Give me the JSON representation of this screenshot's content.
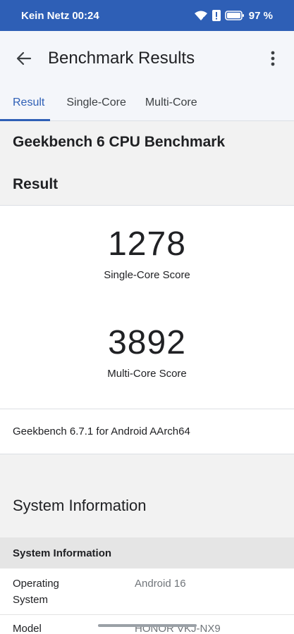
{
  "status_bar": {
    "carrier": "Kein Netz",
    "time": "00:24",
    "battery": "97 %"
  },
  "app_bar": {
    "title": "Benchmark Results",
    "back_icon": "back-arrow-icon",
    "menu_icon": "overflow-menu-icon"
  },
  "tabs": [
    {
      "label": "Result",
      "selected": true
    },
    {
      "label": "Single-Core",
      "selected": false
    },
    {
      "label": "Multi-Core",
      "selected": false
    }
  ],
  "benchmark": {
    "title": "Geekbench 6 CPU Benchmark",
    "result_heading": "Result",
    "single_core": {
      "score": "1278",
      "label": "Single-Core Score"
    },
    "multi_core": {
      "score": "3892",
      "label": "Multi-Core Score"
    },
    "version": "Geekbench 6.7.1 for Android AArch64"
  },
  "system_information": {
    "heading": "System Information",
    "table_header": "System Information",
    "rows": [
      {
        "key": "Operating System",
        "value": "Android 16"
      },
      {
        "key": "Model",
        "value": "HONOR VKJ-NX9"
      }
    ]
  },
  "colors": {
    "accent": "#2e5fb6",
    "status_bar": "#2e5fb6"
  }
}
